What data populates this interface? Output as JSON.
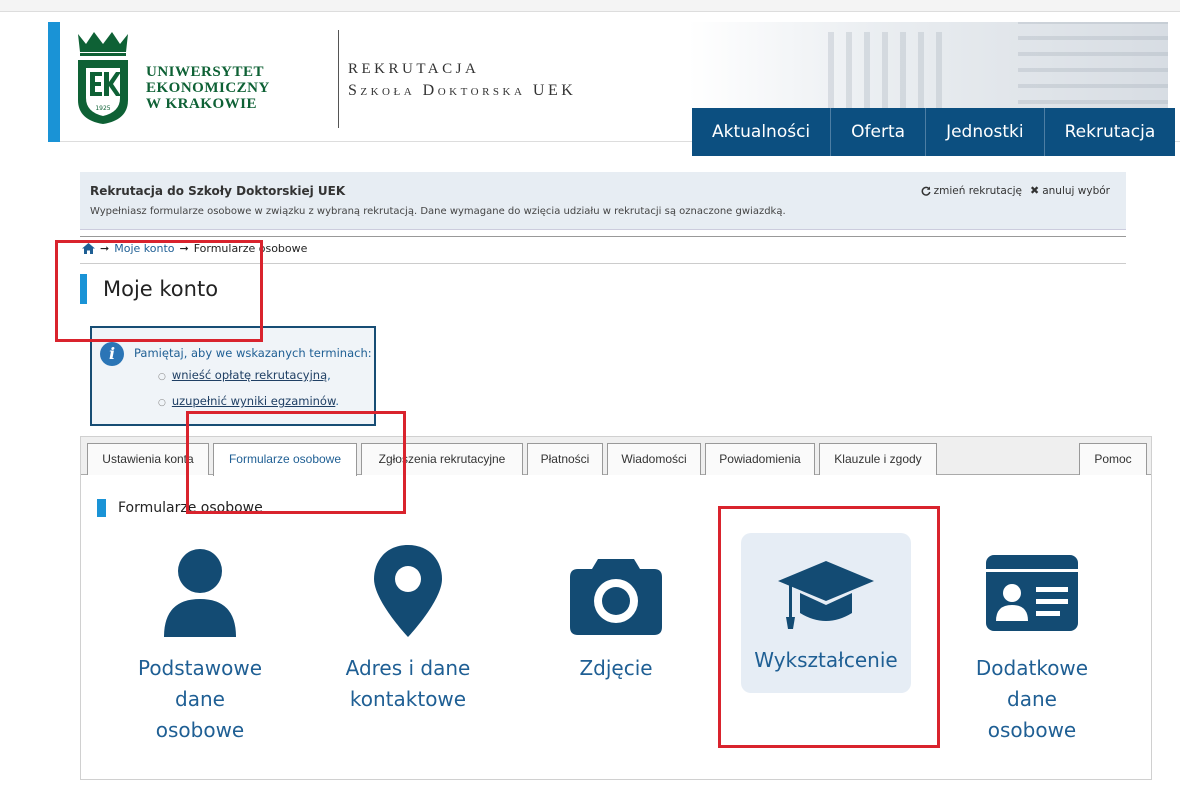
{
  "header": {
    "university_lines": [
      "UNIWERSYTET",
      "EKONOMICZNY",
      "W KRAKOWIE"
    ],
    "logo_year": "1925",
    "rekrutacja_title": "REKRUTACJA",
    "rekrutacja_subtitle": "Szkoła Doktorska UEK"
  },
  "main_nav": [
    "Aktualności",
    "Oferta",
    "Jednostki",
    "Rekrutacja"
  ],
  "info_panel": {
    "title": "Rekrutacja do Szkoły Doktorskiej UEK",
    "text": "Wypełniasz formularze osobowe w związku z wybraną rekrutacją. Dane wymagane do wzięcia udziału w rekrutacji są oznaczone gwiazdką.",
    "change_label": "zmień rekrutację",
    "cancel_label": "anuluj wybór"
  },
  "breadcrumb": {
    "home_icon": "home-icon",
    "items": [
      "Moje konto",
      "Formularze osobowe"
    ],
    "separator": "➞"
  },
  "page_title": "Moje konto",
  "notice": {
    "intro": "Pamiętaj, aby we wskazanych terminach:",
    "links": [
      "wnieść opłatę rekrutacyjną",
      "uzupełnić wyniki egzaminów"
    ],
    "suffixes": [
      ",",
      "."
    ]
  },
  "tabs": [
    "Ustawienia konta",
    "Formularze osobowe",
    "Zgłoszenia rekrutacyjne",
    "Płatności",
    "Wiadomości",
    "Powiadomienia",
    "Klauzule i zgody",
    "Pomoc"
  ],
  "active_tab": "Formularze osobowe",
  "section_title": "Formularze osobowe",
  "cards": [
    {
      "label_lines": [
        "Podstawowe",
        "dane",
        "osobowe"
      ],
      "icon": "user-icon"
    },
    {
      "label_lines": [
        "Adres i dane",
        "kontaktowe"
      ],
      "icon": "map-marker-icon"
    },
    {
      "label_lines": [
        "Zdjęcie"
      ],
      "icon": "camera-icon"
    },
    {
      "label_lines": [
        "Wykształcenie"
      ],
      "icon": "graduation-cap-icon"
    },
    {
      "label_lines": [
        "Dodatkowe",
        "dane",
        "osobowe"
      ],
      "icon": "id-card-icon"
    }
  ],
  "colors": {
    "brand_green": "#0e6135",
    "nav_blue": "#0c4f80",
    "accent_blue": "#1a93d6",
    "icon_blue": "#134b73",
    "link_blue": "#1f5f94",
    "highlight_red": "#d9232d"
  }
}
